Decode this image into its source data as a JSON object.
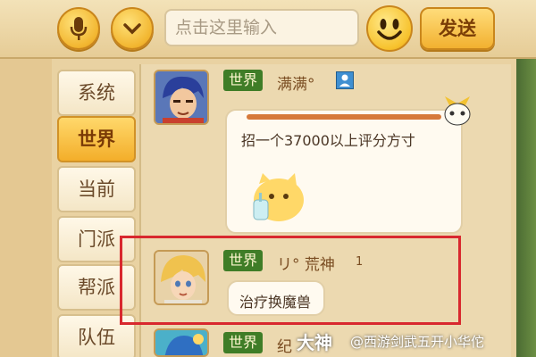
{
  "input": {
    "placeholder": "点击这里输入"
  },
  "send_label": "发送",
  "tabs": [
    "系统",
    "世界",
    "当前",
    "门派",
    "帮派",
    "队伍"
  ],
  "active_tab": "世界",
  "messages": [
    {
      "channel": "世界",
      "sender": "满满°",
      "text": "招一个37000以上评分方寸"
    },
    {
      "channel": "世界",
      "sender": "リ° 荒神",
      "level": "1",
      "text": "治疗换魔兽"
    },
    {
      "channel": "世界",
      "sender": "纪"
    }
  ],
  "watermark": {
    "brand": "大神",
    "handle": "@西游剑武五开小华佗"
  },
  "colors": {
    "accent": "#f3ae2a",
    "channel_tag": "#3f7d27",
    "highlight": "#d8282e"
  }
}
